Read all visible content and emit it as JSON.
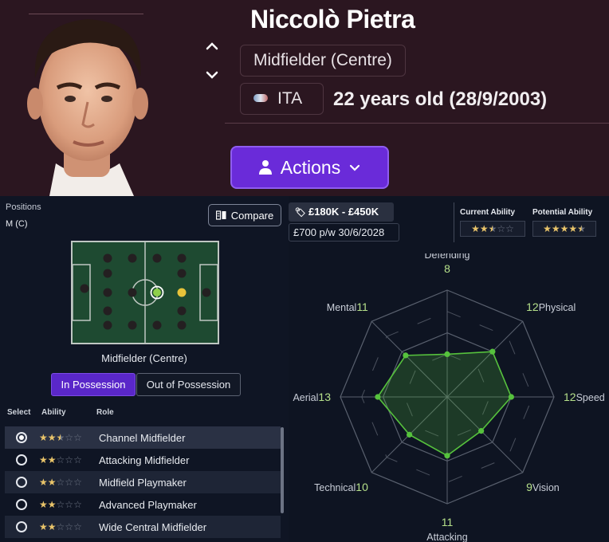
{
  "player": {
    "name": "Niccolò Pietra",
    "position": "Midfielder (Centre)",
    "nationality": "ITA",
    "age_text": "22 years old (28/9/2003)",
    "actions_label": "Actions"
  },
  "positions": {
    "label": "Positions",
    "value": "M (C)",
    "compare_label": "Compare",
    "pitch_caption": "Midfielder (Centre)"
  },
  "tabs": {
    "in_possession": "In Possession",
    "out_of_possession": "Out of Possession"
  },
  "roles_header": {
    "select": "Select",
    "ability": "Ability",
    "role": "Role"
  },
  "roles": [
    {
      "name": "Channel Midfielder",
      "stars": 2.5,
      "selected": true
    },
    {
      "name": "Attacking Midfielder",
      "stars": 2.0,
      "selected": false
    },
    {
      "name": "Midfield Playmaker",
      "stars": 2.0,
      "selected": false
    },
    {
      "name": "Advanced Playmaker",
      "stars": 2.0,
      "selected": false
    },
    {
      "name": "Wide Central Midfielder",
      "stars": 2.0,
      "selected": false
    }
  ],
  "contract": {
    "value_range": "£180K - £450K",
    "wage_expiry": "£700 p/w 30/6/2028"
  },
  "ability": {
    "current_label": "Current Ability",
    "potential_label": "Potential Ability",
    "current_stars": 2.5,
    "potential_stars": 4.5
  },
  "radar": {
    "max": 20,
    "attributes": [
      {
        "name": "Defending",
        "value": 8
      },
      {
        "name": "Physical",
        "value": 12
      },
      {
        "name": "Speed",
        "value": 12
      },
      {
        "name": "Vision",
        "value": 9
      },
      {
        "name": "Attacking",
        "value": 11
      },
      {
        "name": "Technical",
        "value": 10
      },
      {
        "name": "Aerial",
        "value": 13
      },
      {
        "name": "Mental",
        "value": 11
      }
    ]
  },
  "colors": {
    "header_bg": "#2b1620",
    "accent_purple": "#6a2bd9",
    "star_gold": "#e9c46a",
    "radar_green": "#56c23d",
    "value_green": "#b5e08a"
  }
}
